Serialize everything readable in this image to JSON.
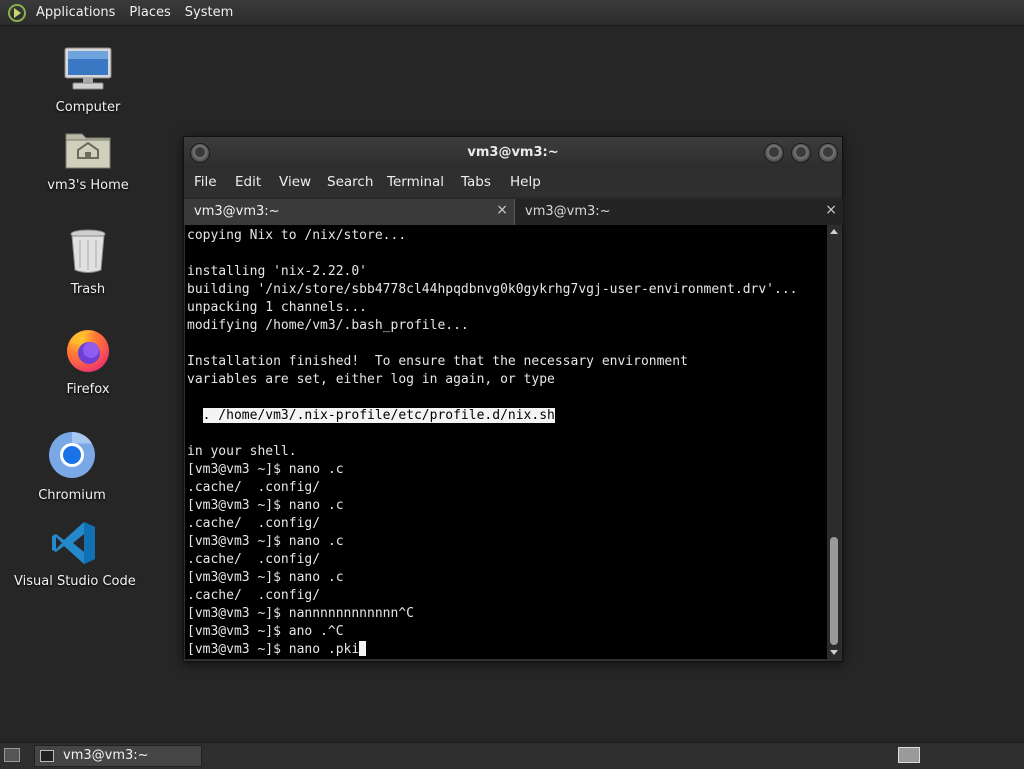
{
  "top_panel": {
    "menus": [
      "Applications",
      "Places",
      "System"
    ]
  },
  "desktop": {
    "icons": [
      {
        "label": "Computer",
        "icon": "computer-icon"
      },
      {
        "label": "vm3's Home",
        "icon": "home-folder-icon"
      },
      {
        "label": "Trash",
        "icon": "trash-icon"
      },
      {
        "label": "Firefox",
        "icon": "firefox-icon"
      },
      {
        "label": "Chromium",
        "icon": "chromium-icon"
      },
      {
        "label": "Visual Studio Code",
        "icon": "vscode-icon"
      }
    ]
  },
  "terminal": {
    "title": "vm3@vm3:~",
    "menu": [
      "File",
      "Edit",
      "View",
      "Search",
      "Terminal",
      "Tabs",
      "Help"
    ],
    "tabs": [
      {
        "label": "vm3@vm3:~",
        "active": true
      },
      {
        "label": "vm3@vm3:~",
        "active": false
      }
    ],
    "close_glyph": "×",
    "lines": [
      "copying Nix to /nix/store...",
      "",
      "installing 'nix-2.22.0'",
      "building '/nix/store/sbb4778cl44hpqdbnvg0k0gykrhg7vgj-user-environment.drv'...",
      "unpacking 1 channels...",
      "modifying /home/vm3/.bash_profile...",
      "",
      "Installation finished!  To ensure that the necessary environment",
      "variables are set, either log in again, or type",
      "",
      "  . /home/vm3/.nix-profile/etc/profile.d/nix.sh",
      "",
      "in your shell.",
      "[vm3@vm3 ~]$ nano .c",
      ".cache/  .config/",
      "[vm3@vm3 ~]$ nano .c",
      ".cache/  .config/",
      "[vm3@vm3 ~]$ nano .c",
      ".cache/  .config/",
      "[vm3@vm3 ~]$ nano .c",
      ".cache/  .config/",
      "[vm3@vm3 ~]$ nannnnnnnnnnnn^C",
      "[vm3@vm3 ~]$ ano .^C",
      "[vm3@vm3 ~]$ nano .pki"
    ],
    "highlighted_line": 10,
    "cursor_line": 23
  },
  "taskbar": {
    "task_label": "vm3@vm3:~"
  }
}
